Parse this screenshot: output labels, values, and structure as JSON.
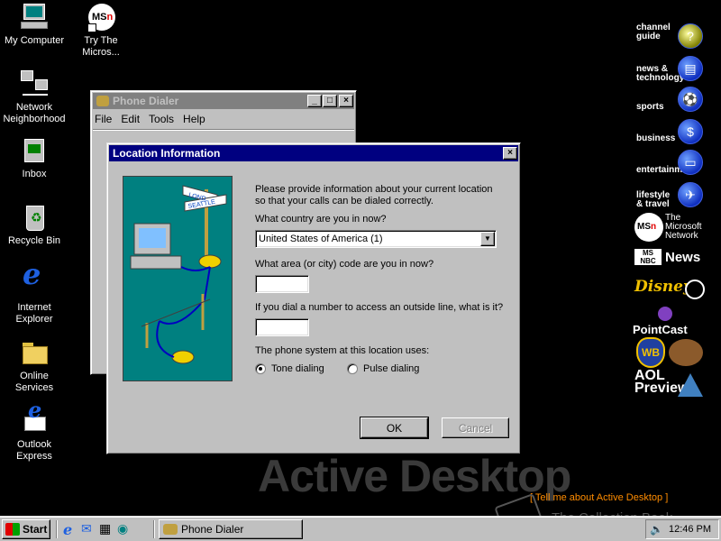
{
  "desktop": {
    "icons": [
      {
        "label": "My Computer"
      },
      {
        "label": "Try The Micros..."
      },
      {
        "label": "Network Neighborhood"
      },
      {
        "label": "Inbox"
      },
      {
        "label": "Recycle Bin"
      },
      {
        "label": "Internet Explorer"
      },
      {
        "label": "Online Services"
      },
      {
        "label": "Outlook Express"
      }
    ],
    "active_desktop_text": "Active Desktop",
    "tell_me_link": "[ Tell me about Active Desktop ]",
    "watermark": "The Collection Book"
  },
  "channel_bar": {
    "items": [
      {
        "label": "channel guide"
      },
      {
        "label": "news & technology"
      },
      {
        "label": "sports"
      },
      {
        "label": "business"
      },
      {
        "label": "entertainment"
      },
      {
        "label": "lifestyle & travel"
      },
      {
        "label": "The Microsoft Network"
      },
      {
        "label": "News"
      },
      {
        "label": "Disney"
      },
      {
        "label": "PointCast"
      },
      {
        "label": "AOL Preview"
      }
    ]
  },
  "phone_dialer": {
    "title": "Phone Dialer",
    "menu": [
      "File",
      "Edit",
      "Tools",
      "Help"
    ]
  },
  "location_dialog": {
    "title": "Location Information",
    "intro": "Please provide information about your current location so that your calls can be dialed correctly.",
    "country_label": "What country are you in now?",
    "country_value": "United States of America (1)",
    "area_label": "What area (or city) code are you in now?",
    "area_value": "",
    "outside_label": "If you dial a number to access an outside line, what is it?",
    "outside_value": "",
    "phone_system_label": "The phone system at this location uses:",
    "tone_label": "Tone dialing",
    "pulse_label": "Pulse dialing",
    "ok_label": "OK",
    "cancel_label": "Cancel",
    "sign_top": "LOND",
    "sign_bottom": "SEATTLE"
  },
  "taskbar": {
    "start_label": "Start",
    "task_label": "Phone Dialer",
    "clock": "12:46 PM"
  },
  "colors": {
    "desktop": "#000000",
    "titlebar_active": "#000080",
    "titlebar_inactive": "#808080",
    "face": "#c0c0c0",
    "dialog_art_bg": "#008080"
  }
}
